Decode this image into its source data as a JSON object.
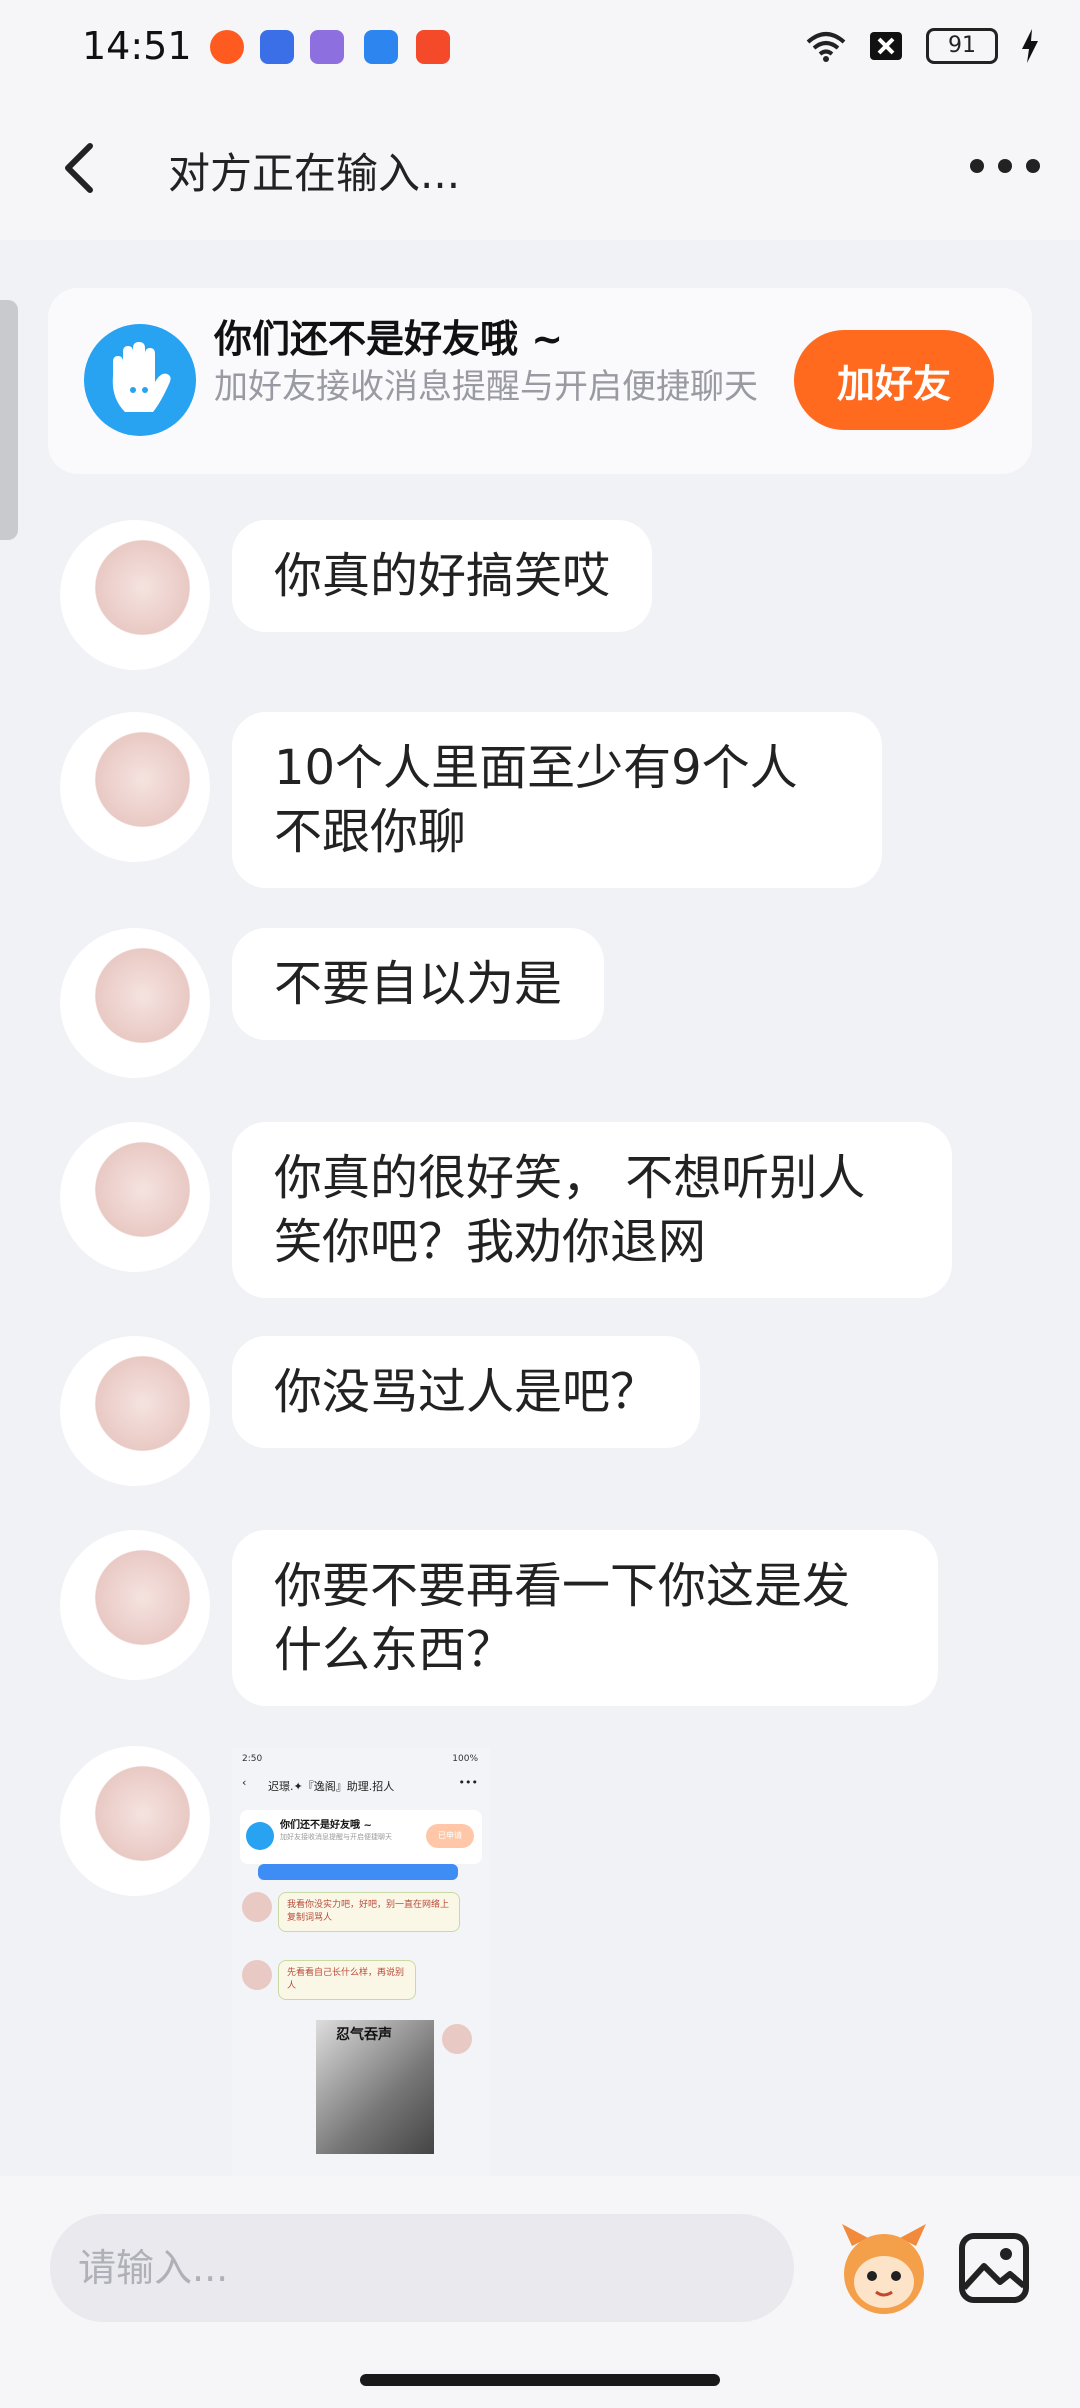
{
  "status_bar": {
    "time": "14:51",
    "battery": "91"
  },
  "header": {
    "title": "对方正在输入..."
  },
  "friend_card": {
    "title": "你们还不是好友哦 ~",
    "subtitle": "加好友接收消息提醒与开启便捷聊天",
    "button": "加好友"
  },
  "messages": [
    {
      "text": "你真的好搞笑哎"
    },
    {
      "text": "10个人里面至少有9个人不跟你聊"
    },
    {
      "text": "不要自以为是"
    },
    {
      "text": "你真的很好笑， 不想听别人笑你吧？我劝你退网"
    },
    {
      "text": "你没骂过人是吧？"
    },
    {
      "text": "你要不要再看一下你这是发什么东西？"
    }
  ],
  "screenshot": {
    "time": "2:50",
    "battery": "100%",
    "title": "迟璟.✦『逸阁』助理.招人",
    "card_title": "你们还不是好友哦 ~",
    "card_sub": "加好友接收消息提醒与开启便捷聊天",
    "card_button": "已申请",
    "msg1": "我看你没实力吧，好吧，别一直在网络上复制词骂人",
    "msg2": "先看看自己长什么样，再说别人",
    "sticker_text": "忍气吞声"
  },
  "input": {
    "placeholder": "请输入..."
  },
  "colors": {
    "accent": "#ff6a1f",
    "card_icon": "#27a3f1"
  }
}
